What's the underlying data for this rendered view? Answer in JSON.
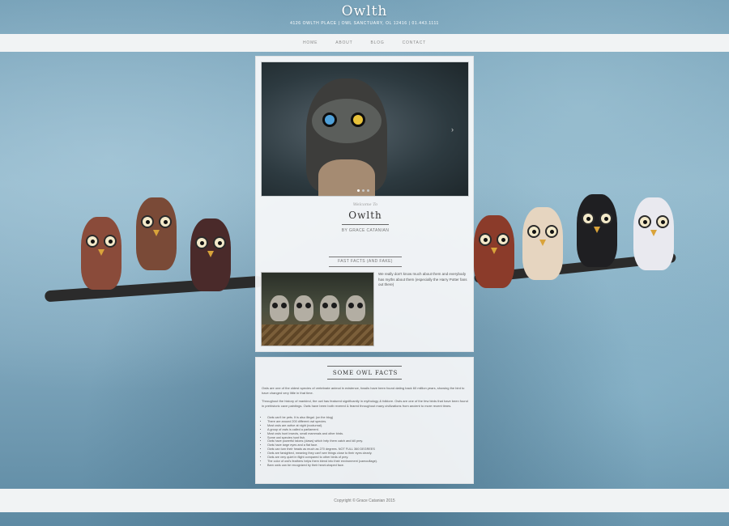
{
  "site": {
    "title": "Owlth",
    "address": "4126 OWLTH PLACE | OWL SANCTUARY, OL 12416 | 01.443.1111"
  },
  "nav": {
    "items": [
      {
        "label": "HOME"
      },
      {
        "label": "ABOUT"
      },
      {
        "label": "BLOG"
      },
      {
        "label": "CONTACT"
      }
    ]
  },
  "hero": {
    "next_symbol": "›",
    "dots": 3,
    "active_dot": 1
  },
  "intro": {
    "welcome": "Welcome To",
    "title": "Owlth",
    "byline": "BY GRACE CATANIAN",
    "section_title": "FAST FACTS (AND FAKE)",
    "text": "We really don't know much about them and everybody has myths about them (especially the Harry Potter fans out there)"
  },
  "facts": {
    "title": "SOME OWL FACTS",
    "p1": "Owls are one of the oldest species of vertebrate animal in existence, fossils have been found dating back 60 million years, showing the bird to have changed very little in that time.",
    "p2": "Throughout the history of mankind, the owl has featured significantly in mythology & folklore. Owls are one of the few birds that have been found in prehistoric cave paintings. Owls have been both revered & feared throughout many civilizations from ancient to more recent times.",
    "list": [
      "Owls can't be pets. It is also illegal. (on the blog)",
      "There are around 200 different owl species.",
      "Most owls are active at night (nocturnal).",
      "A group of owls is called a parliament.",
      "Most owls hunt insects, small mammals and other birds.",
      "Some owl species hunt fish.",
      "Owls have powerful talons (claws) which help them catch and kill prey.",
      "Owls have large eyes and a flat face.",
      "Owls can turn their heads as much as 270 degrees. NOT FULL 360 DEGREES",
      "Owls are farsighted, meaning they can't see things close to their eyes clearly.",
      "Owls are very quiet in flight compared to other birds of prey.",
      "The color of owl's feathers helps them blend into their environment (camouflage).",
      "Barn owls can be recognized by their heart-shaped face."
    ]
  },
  "footer": {
    "copyright": "Copyright © Grace Catanian 2015"
  },
  "colors": {
    "background": "#7fa7bd",
    "nav_bar": "#f1f3f4",
    "card": "#f8f9fa"
  },
  "icons": {
    "carousel_next": "chevron-right-icon"
  }
}
